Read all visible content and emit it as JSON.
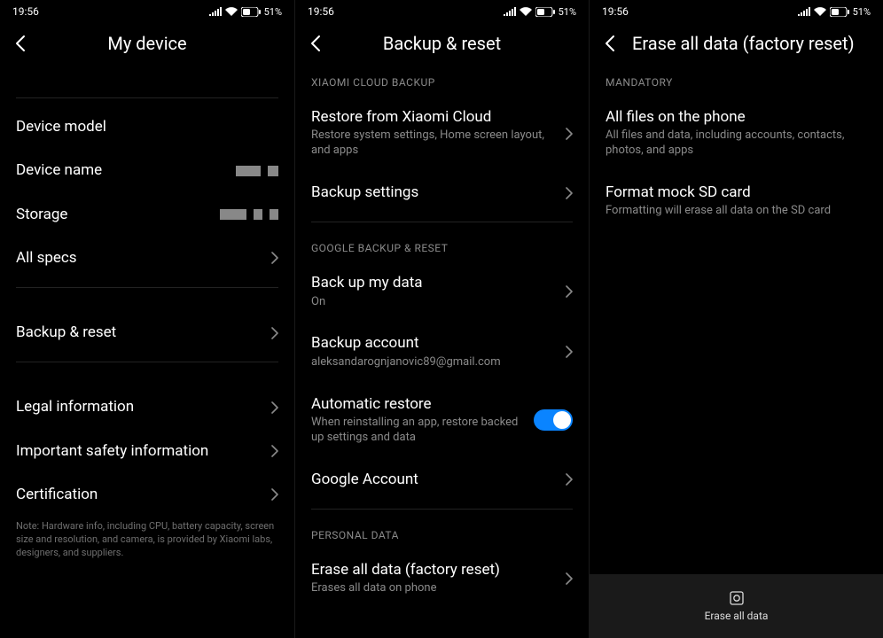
{
  "statusbar": {
    "time": "19:56",
    "battery": "51%"
  },
  "screen1": {
    "title": "My device",
    "rows": {
      "device_model": "Device model",
      "device_name": "Device name",
      "storage": "Storage",
      "all_specs": "All specs",
      "backup_reset": "Backup & reset",
      "legal": "Legal information",
      "safety": "Important safety information",
      "cert": "Certification"
    },
    "note": "Note: Hardware info, including CPU, battery capacity, screen size and resolution, and camera, is provided by Xiaomi labs, designers, and suppliers."
  },
  "screen2": {
    "title": "Backup & reset",
    "sections": {
      "xiaomi": "XIAOMI CLOUD BACKUP",
      "google": "GOOGLE BACKUP & RESET",
      "personal": "PERSONAL DATA"
    },
    "restore_cloud": {
      "title": "Restore from Xiaomi Cloud",
      "sub": "Restore system settings, Home screen layout, and apps"
    },
    "backup_settings": {
      "title": "Backup settings"
    },
    "backup_data": {
      "title": "Back up my data",
      "sub": "On"
    },
    "backup_account": {
      "title": "Backup account",
      "sub": "aleksandarognjanovic89@gmail.com"
    },
    "auto_restore": {
      "title": "Automatic restore",
      "sub": "When reinstalling an app, restore backed up settings and data"
    },
    "google_account": {
      "title": "Google Account"
    },
    "erase": {
      "title": "Erase all data (factory reset)",
      "sub": "Erases all data on phone"
    }
  },
  "screen3": {
    "title": "Erase all data (factory reset)",
    "section": "MANDATORY",
    "all_files": {
      "title": "All files on the phone",
      "sub": "All files and data, including accounts, contacts, photos, and apps"
    },
    "format_sd": {
      "title": "Format mock SD card",
      "sub": "Formatting will erase all data on the SD card"
    },
    "button": "Erase all data"
  }
}
